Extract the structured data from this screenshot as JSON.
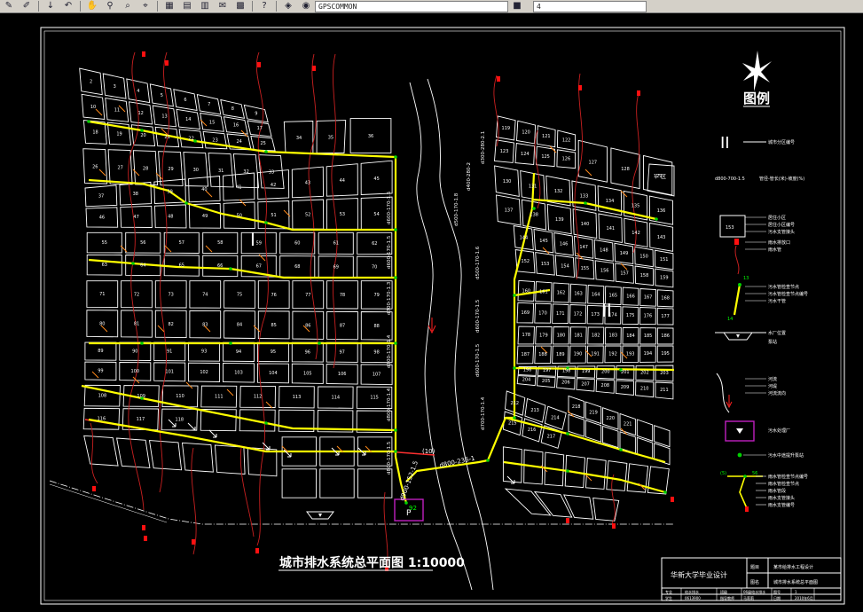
{
  "toolbar": {
    "layer_combo": "GPSCOMMON",
    "color_combo": "4",
    "icons": [
      "brush-icon",
      "pencil-icon",
      "redo-down-icon",
      "undo-icon",
      "pan-icon",
      "zoom-realtime-icon",
      "zoom-window-icon",
      "zoom-previous-icon",
      "properties-icon",
      "design-center-icon",
      "tool-palette-icon",
      "markup-icon",
      "table-icon",
      "help-icon",
      "layer-manager-icon",
      "layer-state-icon",
      "color-control-icon"
    ]
  },
  "drawing": {
    "title": "城市排水系统总平面图 1:10000",
    "legend_title": "图例",
    "district_1": "I",
    "district_2": "II",
    "legend": {
      "roman": "II",
      "roman_desc": "城市分区编号",
      "pipe_spec": "d800-700-1.5",
      "pipe_spec_desc": "管径-管长(米)-坡度(%)",
      "block_label": "153",
      "block_desc": [
        "居住小区",
        "居住小区编号",
        "污水支管接头"
      ],
      "outfall_desc": [
        "雨水排放口",
        "雨水管"
      ],
      "manhole_desc": [
        "污水管检查节点",
        "污水管检查节点编号",
        "污水干管"
      ],
      "manhole_top": "13",
      "manhole_bottom": "14",
      "pump_desc": [
        "水厂位置",
        "泵站"
      ],
      "river_desc": [
        "河流",
        "河堤",
        "河流流向"
      ],
      "plant_desc": "污水处理厂",
      "lift_desc": "污水中途提升泵站",
      "bottom_top": "(5)",
      "bottom_num": "56",
      "bottom_desc": [
        "雨水管检查节点编号",
        "雨水管检查节点",
        "雨水管段",
        "雨水支管接头",
        "雨水支管编号"
      ]
    },
    "title_block": {
      "school": "华新大学毕业设计",
      "label_topic": "题目",
      "topic": "某市给排水工程设计",
      "label_drawing": "图名",
      "drawing_name": "城市排水系统总平面图",
      "label_major": "专业",
      "major": "给水排水",
      "label_class": "班级",
      "class_name": "06级给水排水",
      "label_no": "图号",
      "no": "1",
      "label_student": "学生",
      "student_id": "0613900",
      "label_teacher": "指导教师",
      "teacher": "马莉莉",
      "label_scale": "比例",
      "scale": "1:10000",
      "label_date": "日期",
      "date": "2010年6月"
    },
    "plant_label": "P",
    "plant_pipe": "d900-152-1.5",
    "river_pipe": "d800-236-1",
    "node_labels": [
      "(10)",
      "(9)",
      "(8)",
      "92"
    ],
    "vertical_pipes_left": [
      "d600-170-1.5",
      "d600-170-1.5",
      "d700-170-1.3",
      "d700-170-1.4",
      "d800-170-1.4",
      "d800-170-1.5"
    ],
    "vertical_pipes_right": [
      "d300-280-2.1",
      "d400-280-2",
      "d500-170-1.8",
      "d500-170-1.6",
      "d600-170-1.5",
      "d600-170-1.5",
      "d700-170-1.4"
    ],
    "blocks_left": [
      "2",
      "3",
      "4",
      "5",
      "6",
      "7",
      "8",
      "9",
      "10",
      "11",
      "12",
      "13",
      "14",
      "15",
      "16",
      "17",
      "18",
      "19",
      "20",
      "21",
      "22",
      "23",
      "24",
      "25",
      "26",
      "27",
      "28",
      "29",
      "30",
      "31",
      "32",
      "33",
      "34",
      "35",
      "36",
      "37",
      "38",
      "39",
      "40",
      "41",
      "42",
      "43",
      "44",
      "45",
      "46",
      "47",
      "48",
      "49",
      "50",
      "51",
      "52",
      "53",
      "54",
      "55",
      "56",
      "57",
      "58",
      "59",
      "60",
      "61",
      "62",
      "63",
      "64",
      "65",
      "66",
      "67",
      "68",
      "69",
      "70",
      "71",
      "72",
      "73",
      "74",
      "75",
      "76",
      "77",
      "78",
      "79",
      "80",
      "81",
      "82",
      "83",
      "84",
      "85",
      "86",
      "87",
      "88",
      "89",
      "90",
      "91",
      "93",
      "94",
      "95",
      "96",
      "97",
      "98",
      "99",
      "100",
      "101",
      "102",
      "103",
      "104",
      "105",
      "106",
      "107",
      "108",
      "109",
      "110",
      "111",
      "112",
      "113",
      "114",
      "115",
      "116",
      "117",
      "118"
    ],
    "blocks_right": [
      "119",
      "120",
      "121",
      "122",
      "123",
      "124",
      "125",
      "126",
      "127",
      "128",
      "129",
      "130",
      "131",
      "132",
      "133",
      "134",
      "135",
      "136",
      "137",
      "138",
      "139",
      "140",
      "141",
      "142",
      "143",
      "144",
      "145",
      "146",
      "147",
      "148",
      "149",
      "150",
      "151",
      "152",
      "153",
      "154",
      "155",
      "156",
      "157",
      "158",
      "159",
      "160",
      "161",
      "162",
      "163",
      "164",
      "165",
      "166",
      "167",
      "168",
      "169",
      "170",
      "171",
      "172",
      "173",
      "174",
      "175",
      "176",
      "177",
      "178",
      "179",
      "180",
      "181",
      "182",
      "183",
      "184",
      "185",
      "186",
      "187",
      "188",
      "189",
      "190",
      "191",
      "192",
      "193",
      "194",
      "195",
      "196",
      "197",
      "198",
      "199",
      "200",
      "201",
      "202",
      "203",
      "204",
      "205",
      "206",
      "207",
      "208",
      "209",
      "210",
      "211",
      "212",
      "213",
      "214",
      "215",
      "216",
      "217",
      "218",
      "219",
      "220",
      "221"
    ],
    "side_label": "厂区"
  },
  "colors": {
    "background": "#000000",
    "block": "#ffffff",
    "sewer": "#ffff00",
    "sewer_node": "#00d000",
    "storm": "#ff3030",
    "outfall": "#ff1010",
    "stream": "#c82020",
    "arrow": "#ff8a1a",
    "plant": "#c020c0"
  }
}
